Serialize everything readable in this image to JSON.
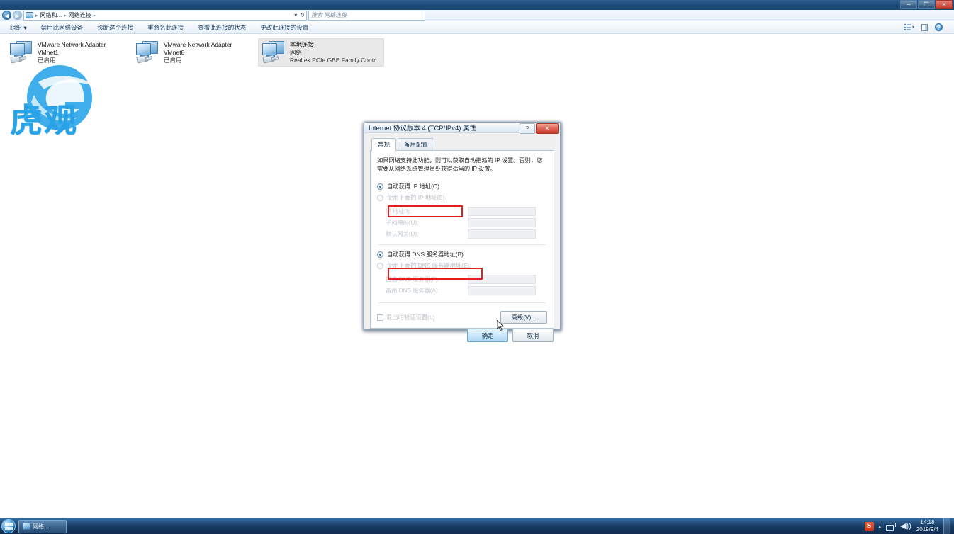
{
  "window": {
    "controls": {
      "minimize": "─",
      "maximize": "❐",
      "close": "✕"
    }
  },
  "address_bar": {
    "back_icon": "◀",
    "forward_icon": "▶",
    "breadcrumbs": [
      "网络和...",
      "网络连接"
    ],
    "separator": "▸",
    "dropdown_caret": "▾",
    "refresh_icon": "↻",
    "search_placeholder": "搜索 网络连接"
  },
  "command_bar": {
    "organize": "组织 ▾",
    "items": [
      "禁用此网络设备",
      "诊断这个连接",
      "重命名此连接",
      "查看此连接的状态",
      "更改此连接的设置"
    ],
    "view_caret": "▾",
    "help_glyph": "?"
  },
  "adapters": [
    {
      "name": "VMware Network Adapter VMnet1",
      "line2": "已启用",
      "line3": "",
      "selected": false
    },
    {
      "name": "VMware Network Adapter VMnet8",
      "line2": "已启用",
      "line3": "",
      "selected": false
    },
    {
      "name": "本地连接",
      "line2": "网络",
      "line3": "Realtek PCIe GBE Family Contr...",
      "selected": true
    }
  ],
  "watermark": {
    "text": "虎观"
  },
  "dialog": {
    "title": "Internet 协议版本 4 (TCP/IPv4) 属性",
    "help_button": "?",
    "close_button": "✕",
    "tabs": [
      {
        "label": "常规",
        "active": true
      },
      {
        "label": "备用配置",
        "active": false
      }
    ],
    "description": "如果网络支持此功能，则可以获取自动指派的 IP 设置。否则，您需要从网络系统管理员处获得适当的 IP 设置。",
    "ip_auto_label": "自动获得 IP 地址(O)",
    "ip_manual_label": "使用下面的 IP 地址(S):",
    "ip_fields": [
      {
        "label": "IP 地址(I):",
        "value": ""
      },
      {
        "label": "子网掩码(U):",
        "value": ""
      },
      {
        "label": "默认网关(D):",
        "value": ""
      }
    ],
    "dns_auto_label": "自动获得 DNS 服务器地址(B)",
    "dns_manual_label": "使用下面的 DNS 服务器地址(E):",
    "dns_fields": [
      {
        "label": "首选 DNS 服务器(P):",
        "value": ""
      },
      {
        "label": "备用 DNS 服务器(A):",
        "value": ""
      }
    ],
    "validate_checkbox_label": "退出时验证设置(L)",
    "advanced_button": "高级(V)...",
    "ok_button": "确定",
    "cancel_button": "取消",
    "ip_dot": ".",
    "highlight_color": "#e02020"
  },
  "taskbar": {
    "task_label": "网络...",
    "tray_caret": "▴",
    "tray_sogou": "S",
    "volume_glyph": "◀))",
    "time": "14:18",
    "date": "2019/9/4"
  }
}
